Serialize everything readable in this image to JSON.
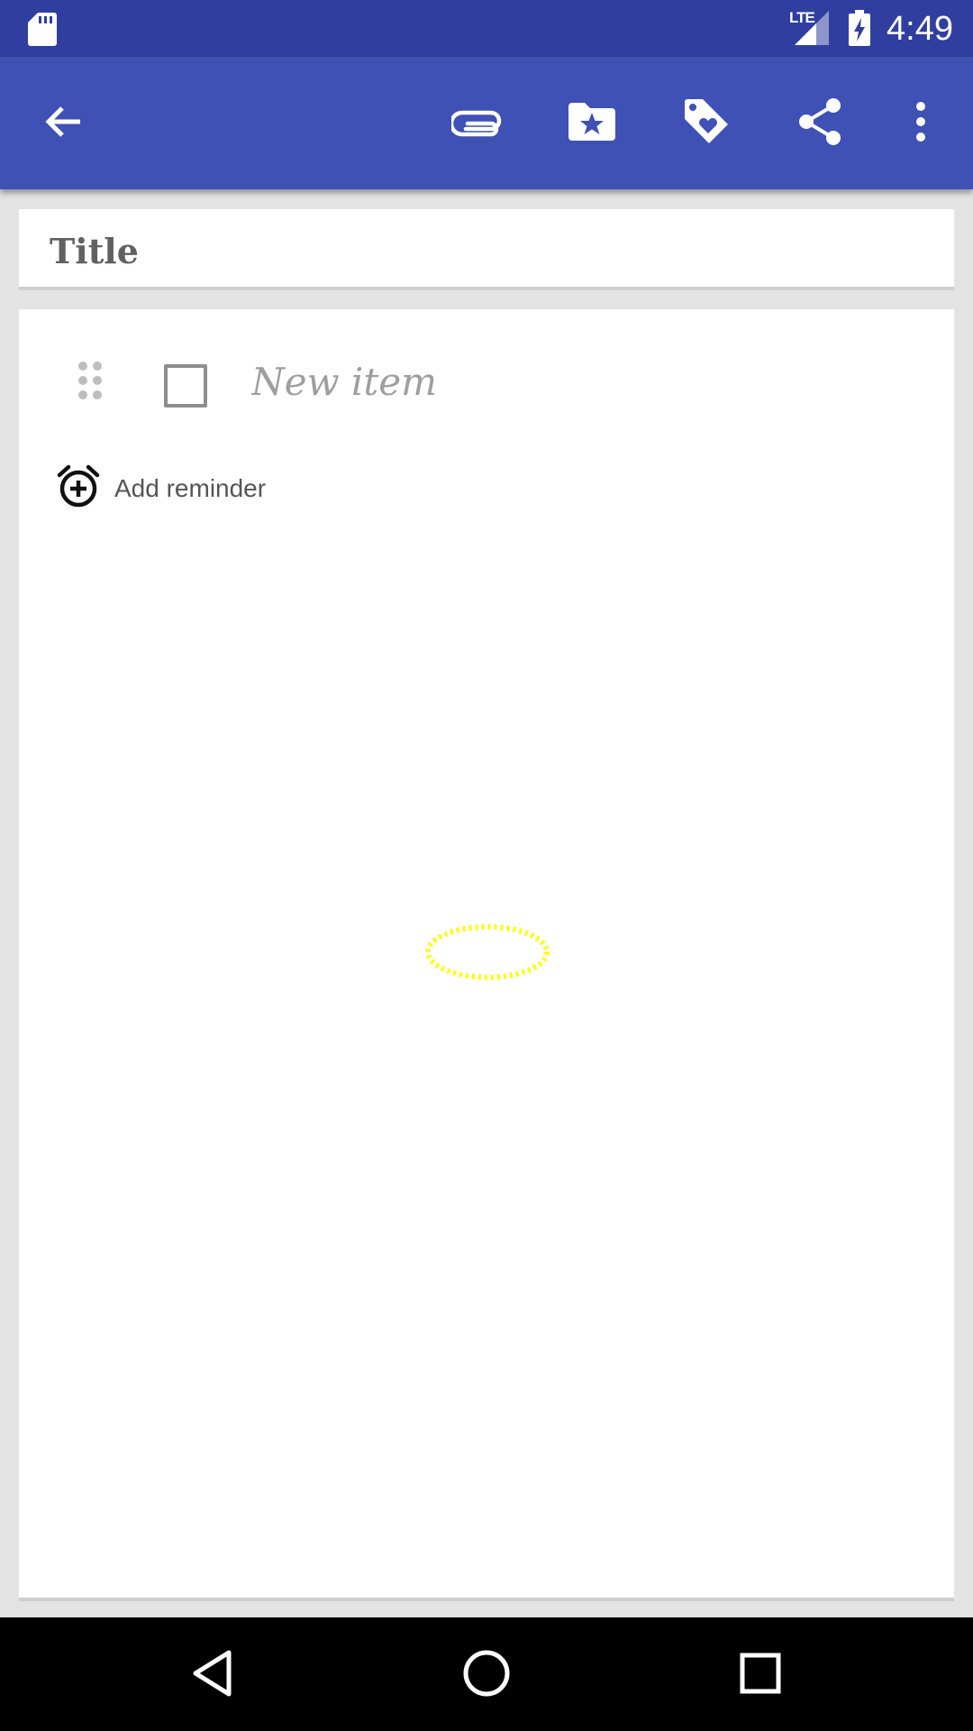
{
  "status_bar": {
    "time": "4:49",
    "network_label": "LTE",
    "icons": [
      "sd-card-icon",
      "signal-icon",
      "battery-charging-icon"
    ]
  },
  "toolbar": {
    "icons": [
      "back-arrow-icon",
      "attachment-icon",
      "folder-star-icon",
      "tag-heart-icon",
      "share-icon",
      "more-vert-icon"
    ]
  },
  "note": {
    "title_placeholder": "Title",
    "item_placeholder": "New item",
    "reminder_label": "Add reminder"
  },
  "colors": {
    "status_bar": "#303f9f",
    "toolbar": "#3f51b5",
    "background": "#e3e3e3",
    "touch_marker": "#ffff00"
  },
  "nav_bar": {
    "icons": [
      "back-triangle-icon",
      "home-circle-icon",
      "recents-square-icon"
    ]
  }
}
